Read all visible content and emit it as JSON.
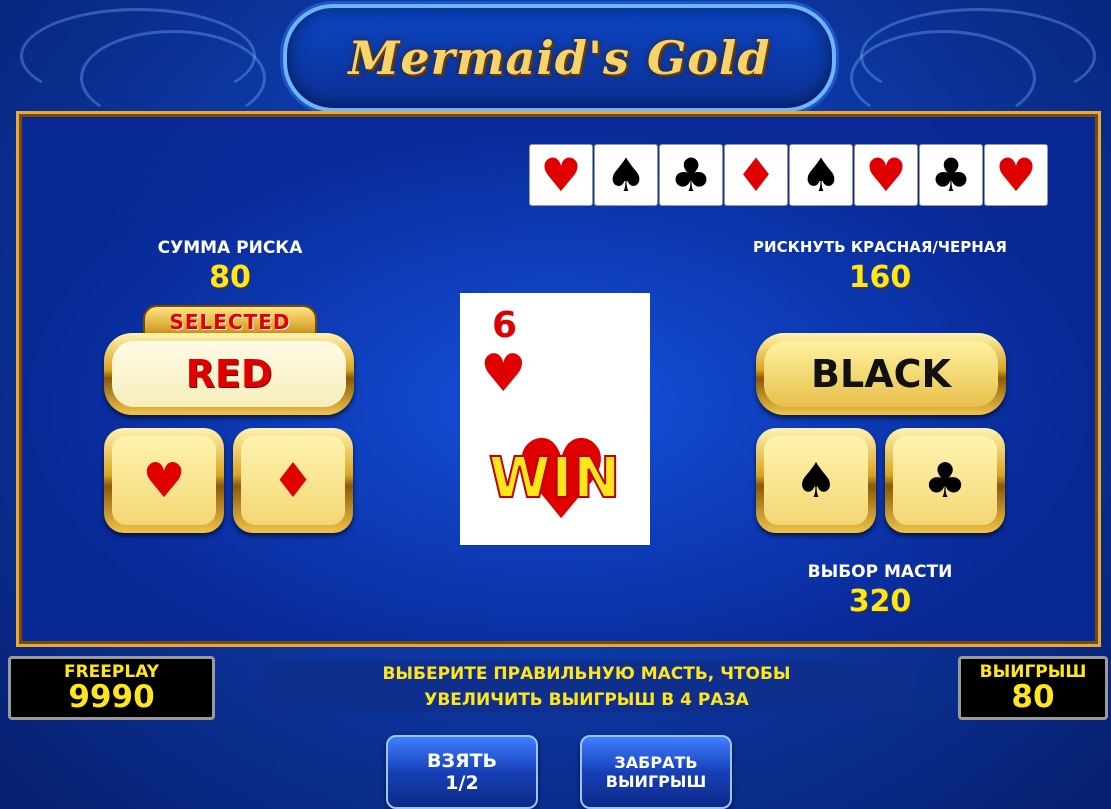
{
  "title": "Mermaid's Gold",
  "history": [
    {
      "suit": "hearts",
      "glyph": "♥",
      "color": "#e00000"
    },
    {
      "suit": "spades",
      "glyph": "♠",
      "color": "#000000"
    },
    {
      "suit": "clubs",
      "glyph": "♣",
      "color": "#000000"
    },
    {
      "suit": "diamonds",
      "glyph": "♦",
      "color": "#e00000"
    },
    {
      "suit": "spades",
      "glyph": "♠",
      "color": "#000000"
    },
    {
      "suit": "hearts",
      "glyph": "♥",
      "color": "#e00000"
    },
    {
      "suit": "clubs",
      "glyph": "♣",
      "color": "#000000"
    },
    {
      "suit": "hearts",
      "glyph": "♥",
      "color": "#e00000"
    }
  ],
  "left": {
    "label": "СУММА РИСКА",
    "value": "80",
    "selected_badge": "SELECTED",
    "color_button": "RED"
  },
  "right": {
    "label": "РИСКНУТЬ КРАСНАЯ/ЧЕРНАЯ",
    "value": "160",
    "color_button": "BLACK",
    "suit_label": "ВЫБОР МАСТИ",
    "suit_value": "320"
  },
  "suit_buttons": {
    "hearts": "♥",
    "diamonds": "♦",
    "spades": "♠",
    "clubs": "♣"
  },
  "card": {
    "rank": "6",
    "suit_glyph": "♥",
    "result": "WIN"
  },
  "freeplay": {
    "label": "FREEPLAY",
    "value": "9990"
  },
  "message": {
    "line1": "ВЫБЕРИТЕ ПРАВИЛЬНУЮ МАСТЬ, ЧТОБЫ",
    "line2": "УВЕЛИЧИТЬ ВЫИГРЫШ В 4 РАЗА"
  },
  "winnings": {
    "label": "ВЫИГРЫШ",
    "value": "80"
  },
  "buttons": {
    "take_label": "ВЗЯТЬ",
    "take_fraction": "1/2",
    "collect_line1": "ЗАБРАТЬ",
    "collect_line2": "ВЫИГРЫШ"
  },
  "colors": {
    "accent_gold": "#e7a93c",
    "value_yellow": "#ffe61a",
    "suit_red": "#e00000"
  }
}
